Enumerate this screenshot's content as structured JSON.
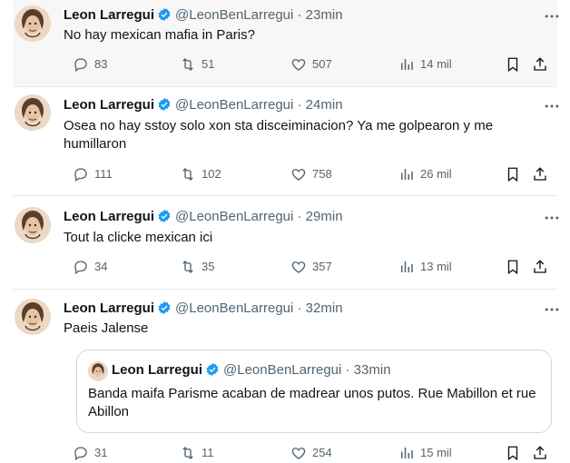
{
  "tweets": [
    {
      "name": "Leon Larregui",
      "handle": "@LeonBenLarregui",
      "time": "· 23min",
      "text": "No hay mexican mafia in Paris?",
      "replies": "83",
      "retweets": "51",
      "likes": "507",
      "views": "14 mil"
    },
    {
      "name": "Leon Larregui",
      "handle": "@LeonBenLarregui",
      "time": "· 24min",
      "text": "Osea no hay sstoy solo xon sta disceiminacion? Ya me golpearon y me humillaron",
      "replies": "111",
      "retweets": "102",
      "likes": "758",
      "views": "26 mil"
    },
    {
      "name": "Leon Larregui",
      "handle": "@LeonBenLarregui",
      "time": "· 29min",
      "text": "Tout la clicke  mexican ici",
      "replies": "34",
      "retweets": "35",
      "likes": "357",
      "views": "13 mil"
    },
    {
      "name": "Leon Larregui",
      "handle": "@LeonBenLarregui",
      "time": "· 32min",
      "text": "Paeis Jalense",
      "replies": "31",
      "retweets": "11",
      "likes": "254",
      "views": "15 mil",
      "quote": {
        "name": "Leon Larregui",
        "handle": "@LeonBenLarregui",
        "time": "· 33min",
        "text": "Banda maifa Parisme acaban de madrear unos putos. Rue Mabillon et rue Abillon"
      }
    }
  ],
  "colors": {
    "verified": "#1d9bf0",
    "secondary": "#536471"
  },
  "icons": [
    "reply-icon",
    "retweet-icon",
    "like-icon",
    "views-icon",
    "bookmark-icon",
    "share-icon",
    "more-icon",
    "verified-icon"
  ]
}
